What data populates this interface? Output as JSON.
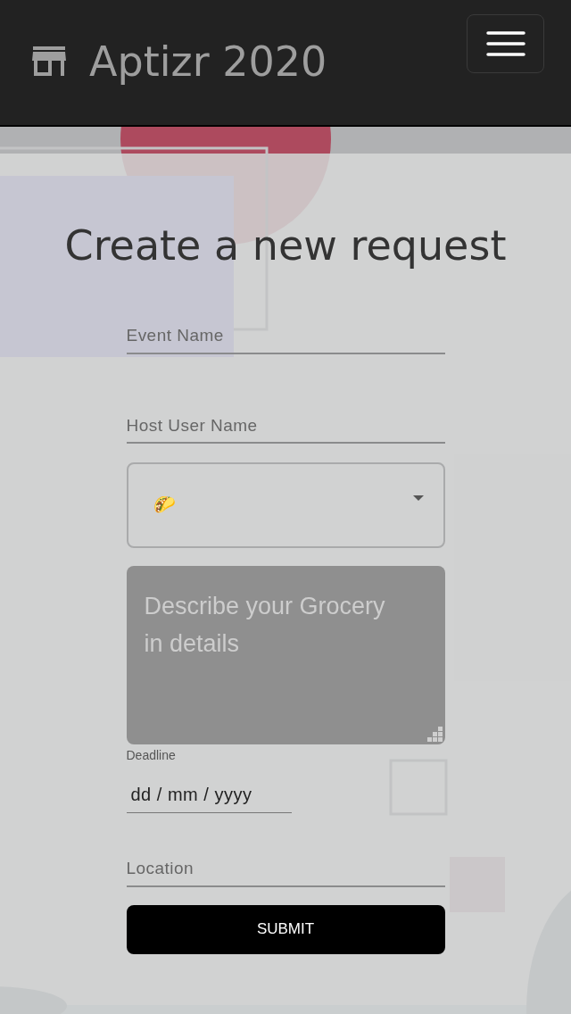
{
  "navbar": {
    "brand": "Aptizr 2020"
  },
  "page": {
    "title": "Create a new request"
  },
  "form": {
    "event_name": {
      "placeholder": "Event Name"
    },
    "host_user_name": {
      "placeholder": "Host User Name"
    },
    "category_select": {
      "value": "🌮"
    },
    "description": {
      "placeholder": "Describe your Grocery in details"
    },
    "deadline": {
      "label": "Deadline",
      "value": "dd / mm / yyyy"
    },
    "location": {
      "placeholder": "Location"
    },
    "submit": "SUBMIT"
  }
}
